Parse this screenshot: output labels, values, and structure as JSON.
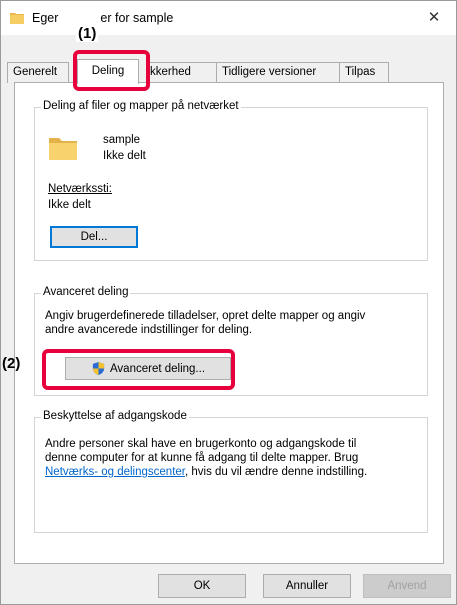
{
  "window": {
    "title_part1": "Eger",
    "title_part2": "er for sample",
    "close_glyph": "✕"
  },
  "tabs": [
    {
      "label": "Generelt"
    },
    {
      "label": "Deling"
    },
    {
      "label": "kkerhed"
    },
    {
      "label": "Tidligere versioner"
    },
    {
      "label": "Tilpas"
    }
  ],
  "sharing_group": {
    "label": "Deling af filer og mapper på netværket",
    "folder_name": "sample",
    "folder_status": "Ikke delt",
    "network_path_label": "Netværkssti:",
    "network_path_value": "Ikke delt",
    "share_button": "Del..."
  },
  "advanced_group": {
    "label": "Avanceret deling",
    "description_line1": "Angiv brugerdefinerede tilladelser, opret delte mapper og angiv",
    "description_line2": "andre avancerede indstillinger for deling.",
    "advanced_button": "Avanceret deling..."
  },
  "password_group": {
    "label": "Beskyttelse af adgangskode",
    "line1": "Andre personer skal have en brugerkonto og adgangskode til",
    "line2": "denne computer for at kunne få adgang til delte mapper. Brug",
    "link": "Netværks- og delingscenter",
    "line3_rest": ", hvis du vil ændre denne indstilling."
  },
  "footer": {
    "ok": "OK",
    "cancel": "Annuller",
    "apply": "Anvend"
  },
  "callouts": {
    "one": "(1)",
    "two": "(2)"
  },
  "colors": {
    "highlight": "#e8003c",
    "link": "#0066cc",
    "focus": "#0078d7"
  }
}
